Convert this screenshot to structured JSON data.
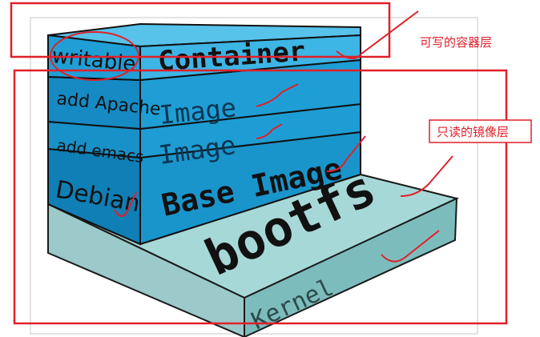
{
  "layers": {
    "container": {
      "side_label": "writable",
      "front_label": "Container"
    },
    "apache": {
      "side_label": "add Apache",
      "front_label": "Image"
    },
    "emacs": {
      "side_label": "add emacs",
      "front_label": "Image"
    },
    "debian": {
      "side_label": "Debian",
      "front_label": "Base Image"
    },
    "bootfs": {
      "top_label": "bootfs",
      "front_label": "Kernel"
    }
  },
  "annotations": {
    "writable_layer_note": "可写的容器层",
    "readonly_layers_note": "只读的镜像层"
  },
  "colors": {
    "layer_blue_light": "#3fb8e6",
    "layer_blue_mid": "#1c98d0",
    "layer_blue_dark": "#0d6fa3",
    "bootfs_top": "#a4d6d6",
    "bootfs_side": "#7fbfc0",
    "annotation_red": "#e0202a"
  }
}
